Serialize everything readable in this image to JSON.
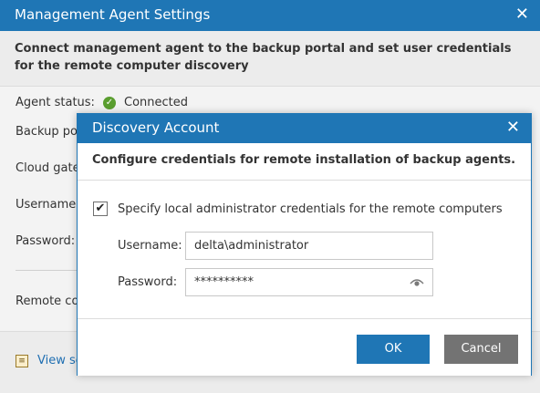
{
  "background_window": {
    "title": "Management Agent Settings",
    "close_glyph": "✕",
    "header_text": "Connect management agent to the backup portal and set user credentials for the remote computer discovery",
    "fields": {
      "agent_status_label": "Agent status:",
      "agent_status_value": "Connected",
      "backup_portal_label": "Backup por",
      "cloud_gateway_label": "Cloud gatew",
      "username_label": "Username:",
      "password_label": "Password:",
      "remote_computer_label": "Remote co"
    },
    "footer_link": "View se"
  },
  "dialog": {
    "title": "Discovery Account",
    "close_glyph": "✕",
    "subtitle": "Configure credentials for remote installation of backup agents.",
    "checkbox": {
      "label": "Specify local administrator credentials for the remote computers",
      "checked": true,
      "glyph": "✔"
    },
    "username": {
      "label": "Username:",
      "value": "delta\\administrator"
    },
    "password": {
      "label": "Password:",
      "value": "**********",
      "reveal_icon": "eye-icon"
    },
    "ok_label": "OK",
    "cancel_label": "Cancel"
  },
  "colors": {
    "title_bar": "#1f76b5",
    "ok_button": "#1f76b5",
    "cancel_button": "#737373",
    "status_connected": "#5a9e2f",
    "link": "#1f6fb2"
  }
}
